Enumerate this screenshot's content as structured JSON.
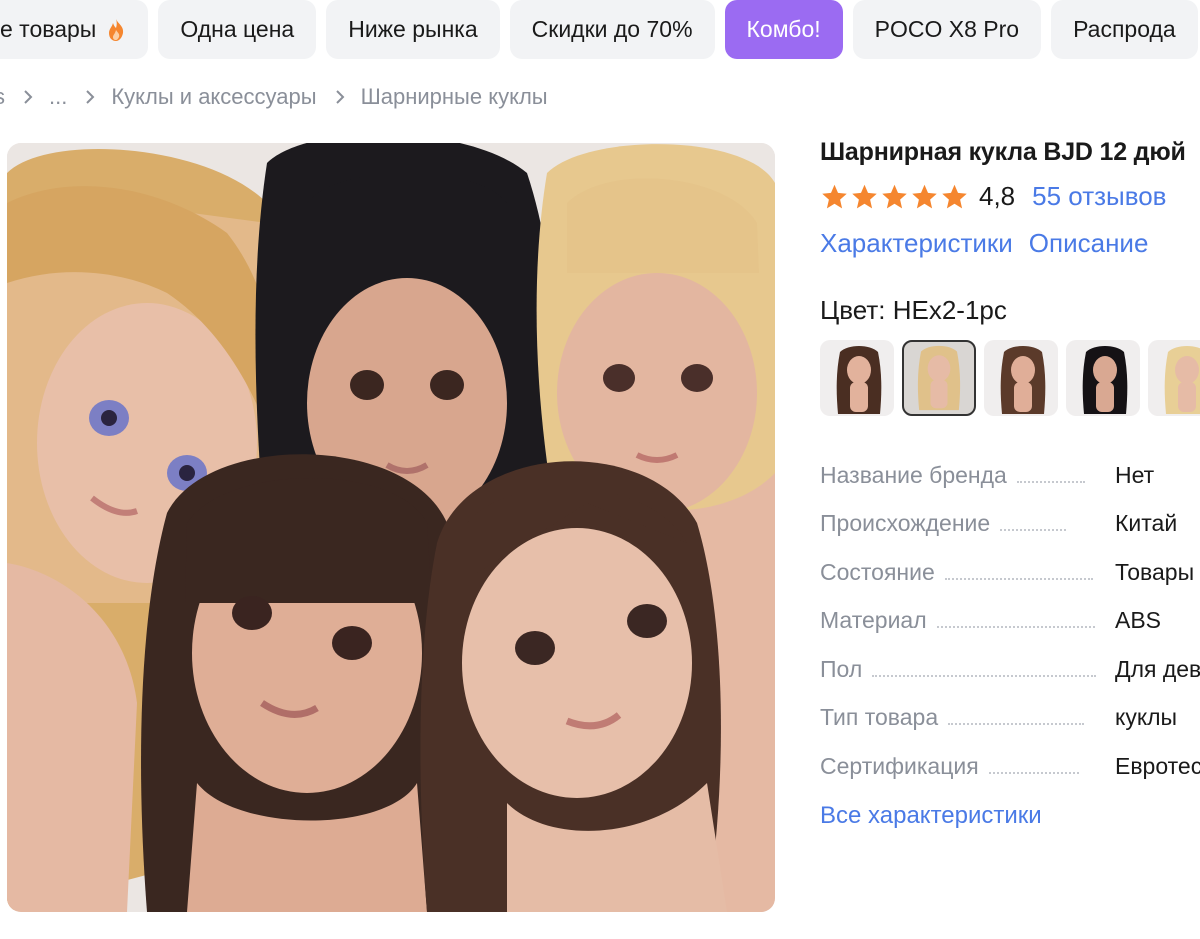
{
  "chips": [
    {
      "label": "е товары",
      "icon": "fire-icon",
      "active": false
    },
    {
      "label": "Одна цена",
      "active": false
    },
    {
      "label": "Ниже рынка",
      "active": false
    },
    {
      "label": "Скидки до 70%",
      "active": false
    },
    {
      "label": "Комбо!",
      "active": true
    },
    {
      "label": "POCO X8 Pro",
      "active": false
    },
    {
      "label": "Распрода",
      "active": false
    }
  ],
  "breadcrumb": [
    "s",
    "...",
    "Куклы и аксессуары",
    "Шарнирные куклы"
  ],
  "product": {
    "title": "Шарнирная кукла BJD 12 дюй",
    "rating": "4,8",
    "stars": 5,
    "reviews": "55 отзывов",
    "tabs": [
      "Характеристики",
      "Описание"
    ],
    "color_label": "Цвет: HEx2-1pc",
    "swatches": [
      {
        "hair": "#4a2e22",
        "selected": false
      },
      {
        "hair": "#e0c18a",
        "selected": true
      },
      {
        "hair": "#5b3a2a",
        "selected": false
      },
      {
        "hair": "#151215",
        "selected": false
      },
      {
        "hair": "#e8cf96",
        "selected": false
      }
    ],
    "specs": [
      {
        "key": "Название бренда",
        "value": "Нет"
      },
      {
        "key": "Происхождение",
        "value": "Китай"
      },
      {
        "key": "Состояние",
        "value": "Товары"
      },
      {
        "key": "Материал",
        "value": "ABS"
      },
      {
        "key": "Пол",
        "value": "Для дев"
      },
      {
        "key": "Тип товара",
        "value": "куклы"
      },
      {
        "key": "Сертификация",
        "value": "Евротес"
      }
    ],
    "all_specs_label": "Все характеристики"
  },
  "colors": {
    "accent": "#9b6bf2",
    "link": "#4a7ae6",
    "star": "#f5862f",
    "muted": "#8a8f99"
  }
}
